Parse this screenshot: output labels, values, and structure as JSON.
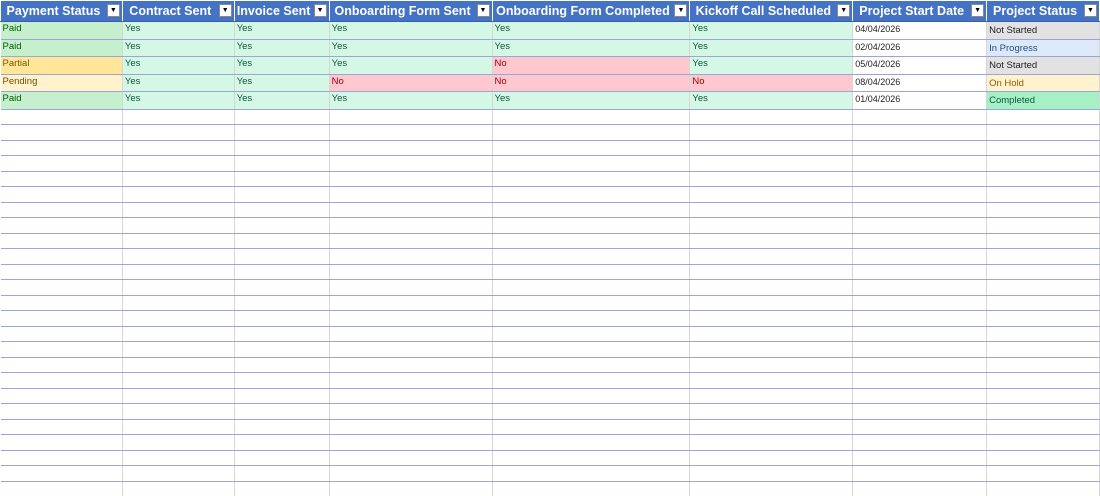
{
  "headers": [
    "Payment Status",
    "Contract Sent",
    "Invoice Sent",
    "Onboarding Form Sent",
    "Onboarding Form Completed",
    "Kickoff Call Scheduled",
    "Project Start Date",
    "Project Status"
  ],
  "filter_icon": "filter-dropdown-icon",
  "colors": {
    "header_bg": "#4472c4",
    "yes_bg": "#d5f7e6",
    "no_bg": "#ffc7ce",
    "paid_bg": "#c6efce",
    "partial_bg": "#ffe699",
    "pending_bg": "#fff2cc",
    "not_started_bg": "#e2e2e2",
    "in_progress_bg": "#dde9f8",
    "on_hold_bg": "#fff2cc",
    "completed_bg": "#a6f0c6"
  },
  "rows": [
    [
      "Paid",
      "Yes",
      "Yes",
      "Yes",
      "Yes",
      "Yes",
      "04/04/2026",
      "Not Started"
    ],
    [
      "Paid",
      "Yes",
      "Yes",
      "Yes",
      "Yes",
      "Yes",
      "02/04/2026",
      "In Progress"
    ],
    [
      "Partial",
      "Yes",
      "Yes",
      "Yes",
      "No",
      "Yes",
      "05/04/2026",
      "Not Started"
    ],
    [
      "Pending",
      "Yes",
      "Yes",
      "No",
      "No",
      "No",
      "08/04/2026",
      "On Hold"
    ],
    [
      "Paid",
      "Yes",
      "Yes",
      "Yes",
      "Yes",
      "Yes",
      "01/04/2026",
      "Completed"
    ]
  ]
}
